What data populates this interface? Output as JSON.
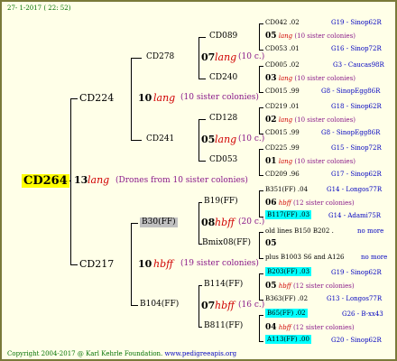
{
  "header": {
    "date": "27- 1-2017 ( 22: 52)"
  },
  "root": {
    "code": "CD264",
    "gen": "13",
    "breed": "lang",
    "note": "(Drones from 10 sister colonies)"
  },
  "g1": [
    {
      "code": "CD224",
      "gen": "10",
      "breed": "lang",
      "note": "(10 sister colonies)"
    },
    {
      "code": "CD217",
      "gen": "10",
      "breed": "hbff",
      "note": "(19 sister colonies)"
    }
  ],
  "g2": [
    {
      "code": "CD278",
      "gen": "07",
      "breed": "lang",
      "note": "(10 c.)"
    },
    {
      "code": "CD241",
      "gen": "05",
      "breed": "lang",
      "note": "(10 c.)"
    },
    {
      "code": "B30(FF)",
      "gen": "08",
      "breed": "hbff",
      "note": "(20 c.)"
    },
    {
      "code": "B104(FF)",
      "gen": "07",
      "breed": "hbff",
      "note": "(16 c.)"
    }
  ],
  "g3": [
    "CD089",
    "CD240",
    "CD128",
    "CD053",
    "B19(FF)",
    "Bmix08(FF)",
    "B114(FF)",
    "B811(FF)"
  ],
  "g4": [
    {
      "code": "CD042",
      "year": ".02",
      "ref": "G19 - Sinop62R"
    },
    {
      "gen": "05",
      "breed": "lang",
      "note": "(10 sister colonies)"
    },
    {
      "code": "CD053",
      "year": ".01",
      "ref": "G16 - Sinop72R"
    },
    {
      "code": "CD005",
      "year": ".02",
      "ref": "G3 - Caucas98R"
    },
    {
      "gen": "03",
      "breed": "lang",
      "note": "(10 sister colonies)"
    },
    {
      "code": "CD015",
      "year": ".99",
      "ref": "G8 - SinopEgg86R"
    },
    {
      "code": "CD219",
      "year": ".01",
      "ref": "G18 - Sinop62R"
    },
    {
      "gen": "02",
      "breed": "lang",
      "note": "(10 sister colonies)"
    },
    {
      "code": "CD015",
      "year": ".99",
      "ref": "G8 - SinopEgg86R"
    },
    {
      "code": "CD225",
      "year": ".99",
      "ref": "G15 - Sinop72R"
    },
    {
      "gen": "01",
      "breed": "lang",
      "note": "(10 sister colonies)"
    },
    {
      "code": "CD209",
      "year": ".96",
      "ref": "G17 - Sinop62R"
    },
    {
      "code": "B351(FF)",
      "year": ".04",
      "ref": "G14 - Longos77R"
    },
    {
      "gen": "06",
      "breed": "hbff",
      "note": "(12 sister colonies)"
    },
    {
      "code": "B117(FF)",
      "year": ".03",
      "ref": "G14 - Adami75R"
    },
    {
      "text": "old lines B150 B202 .",
      "more": "no more"
    },
    {
      "gen": "05"
    },
    {
      "text": "plus B1003 S6 and A126",
      "more": "no more"
    },
    {
      "code": "B203(FF)",
      "year": ".03",
      "ref": "G19 - Sinop62R"
    },
    {
      "gen": "05",
      "breed": "hbff",
      "note": "(12 sister colonies)"
    },
    {
      "code": "B363(FF)",
      "year": ".02",
      "ref": "G13 - Longos77R"
    },
    {
      "code": "B65(FF)",
      "year": ".02",
      "ref": "G26 - B-xx43"
    },
    {
      "gen": "04",
      "breed": "hbff",
      "note": "(12 sister colonies)"
    },
    {
      "code": "A113(FF)",
      "year": ".00",
      "ref": "G20 - Sinop62R"
    }
  ],
  "footer": {
    "copyright": "Copyright 2004-2017 @ Karl Kehrle Foundation.",
    "url": "www.pedigreeapis.org"
  }
}
